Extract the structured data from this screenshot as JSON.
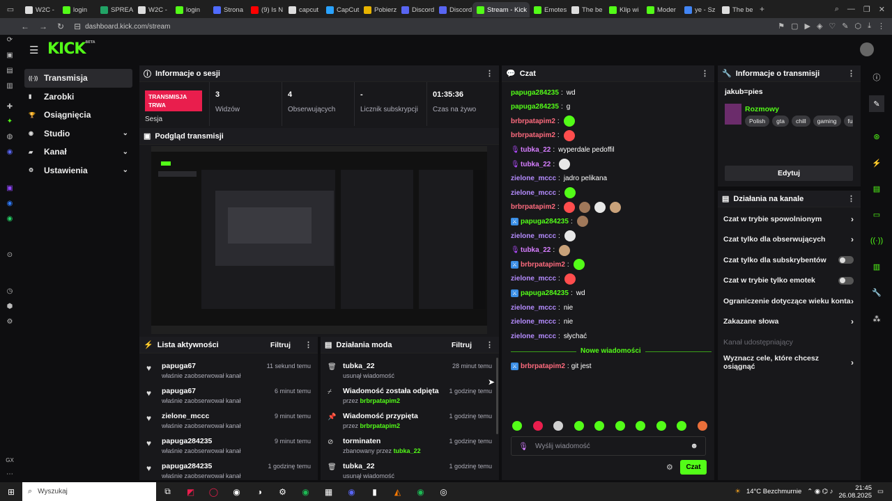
{
  "browser": {
    "tabs": [
      {
        "label": "W2C -",
        "color": "#dddddd"
      },
      {
        "label": "login",
        "color": "#53fc18"
      },
      {
        "label": "SPREAD",
        "color": "#21a366"
      },
      {
        "label": "W2C -",
        "color": "#dddddd"
      },
      {
        "label": "login",
        "color": "#53fc18"
      },
      {
        "label": "Strona",
        "color": "#4f6bff"
      },
      {
        "label": "(9) Is N",
        "color": "#ff0000"
      },
      {
        "label": "capcut",
        "color": "#dddddd"
      },
      {
        "label": "CapCut",
        "color": "#2aa3ff"
      },
      {
        "label": "Pobierz",
        "color": "#e8b400"
      },
      {
        "label": "Discord",
        "color": "#5865f2"
      },
      {
        "label": "Discord",
        "color": "#5865f2"
      },
      {
        "label": "Stream - Kick",
        "color": "#53fc18"
      },
      {
        "label": "Emotes",
        "color": "#53fc18"
      },
      {
        "label": "The be",
        "color": "#dddddd"
      },
      {
        "label": "Klip wi",
        "color": "#53fc18"
      },
      {
        "label": "Moder",
        "color": "#53fc18"
      },
      {
        "label": "ye - Sz",
        "color": "#4285f4"
      },
      {
        "label": "The be",
        "color": "#dddddd"
      }
    ],
    "url": "dashboard.kick.com/stream"
  },
  "site": {
    "logo": "KICK",
    "logo_beta": "BETA"
  },
  "sidebar": {
    "items": [
      {
        "label": "Transmisja",
        "icon": "broadcast-icon",
        "glyph": "((·))",
        "active": true,
        "chevron": false
      },
      {
        "label": "Zarobki",
        "icon": "money-icon",
        "glyph": "▮",
        "active": false,
        "chevron": false
      },
      {
        "label": "Osiągnięcia",
        "icon": "trophy-icon",
        "glyph": "🏆",
        "active": false,
        "chevron": false
      },
      {
        "label": "Studio",
        "icon": "studio-icon",
        "glyph": "◉",
        "active": false,
        "chevron": true
      },
      {
        "label": "Kanał",
        "icon": "channel-icon",
        "glyph": "▰",
        "active": false,
        "chevron": true
      },
      {
        "label": "Ustawienia",
        "icon": "gear-icon",
        "glyph": "⚙",
        "active": false,
        "chevron": true
      }
    ]
  },
  "session": {
    "title": "Informacje o sesji",
    "live_badge": "TRANSMISJA TRWA",
    "live_label": "Sesja",
    "stats": [
      {
        "value": "3",
        "label": "Widzów"
      },
      {
        "value": "4",
        "label": "Obserwujących"
      },
      {
        "value": "-",
        "label": "Licznik subskrypcji"
      },
      {
        "value": "01:35:36",
        "label": "Czas na żywo"
      }
    ]
  },
  "preview": {
    "title": "Podgląd transmisji"
  },
  "activity": {
    "title": "Lista aktywności",
    "filter": "Filtruj",
    "items": [
      {
        "name": "papuga67",
        "sub": "właśnie zaobserwował kanał",
        "time": "11 sekund temu"
      },
      {
        "name": "papuga67",
        "sub": "właśnie zaobserwował kanał",
        "time": "6 minut temu"
      },
      {
        "name": "zielone_mccc",
        "sub": "właśnie zaobserwował kanał",
        "time": "9 minut temu"
      },
      {
        "name": "papuga284235",
        "sub": "właśnie zaobserwował kanał",
        "time": "9 minut temu"
      },
      {
        "name": "papuga284235",
        "sub": "właśnie zaobserwował kanał",
        "time": "1 godzinę temu"
      }
    ]
  },
  "mod": {
    "title": "Działania moda",
    "filter": "Filtruj",
    "items": [
      {
        "name": "tubka_22",
        "sub": "usunął wiadomość",
        "who": "",
        "time": "28 minut temu",
        "icon": "trash-icon",
        "glyph": "🗑"
      },
      {
        "name": "Wiadomość została odpięta",
        "sub": "przez",
        "who": "brbrpatapim2",
        "time": "1 godzinę temu",
        "icon": "unpin-icon",
        "glyph": "⌿"
      },
      {
        "name": "Wiadomość przypięta",
        "sub": "przez",
        "who": "brbrpatapim2",
        "time": "1 godzinę temu",
        "icon": "pin-icon",
        "glyph": "📌"
      },
      {
        "name": "torminaten",
        "sub": "zbanowany przez",
        "who": "tubka_22",
        "time": "1 godzinę temu",
        "icon": "ban-icon",
        "glyph": "⊘"
      },
      {
        "name": "tubka_22",
        "sub": "usunął wiadomość",
        "who": "",
        "time": "1 godzinę temu",
        "icon": "trash-icon",
        "glyph": "🗑"
      }
    ]
  },
  "chat": {
    "title": "Czat",
    "messages": [
      {
        "user": "papuga284235",
        "text": "wd",
        "color": "#53fc18",
        "emotes": 0,
        "badge": ""
      },
      {
        "user": "papuga284235",
        "text": "g",
        "color": "#53fc18",
        "emotes": 0,
        "badge": ""
      },
      {
        "user": "brbrpatapim2",
        "text": "",
        "color": "#ff6b7e",
        "emotes": 1,
        "badge": ""
      },
      {
        "user": "brbrpatapim2",
        "text": "",
        "color": "#ff6b7e",
        "emotes": 1,
        "badge": ""
      },
      {
        "user": "tubka_22",
        "text": "wyperdale pedoffil",
        "color": "#d67eff",
        "emotes": 0,
        "badge": "mic"
      },
      {
        "user": "tubka_22",
        "text": "",
        "color": "#d67eff",
        "emotes": 1,
        "badge": "mic"
      },
      {
        "user": "zielone_mccc",
        "text": "jadro pelikana",
        "color": "#b58cff",
        "emotes": 0,
        "badge": ""
      },
      {
        "user": "zielone_mccc",
        "text": "",
        "color": "#b58cff",
        "emotes": 1,
        "badge": ""
      },
      {
        "user": "brbrpatapim2",
        "text": "",
        "color": "#ff6b7e",
        "emotes": 4,
        "badge": ""
      },
      {
        "user": "papuga284235",
        "text": "",
        "color": "#53fc18",
        "emotes": 1,
        "badge": "mod"
      },
      {
        "user": "zielone_mccc",
        "text": "",
        "color": "#b58cff",
        "emotes": 1,
        "badge": ""
      },
      {
        "user": "tubka_22",
        "text": "",
        "color": "#d67eff",
        "emotes": 1,
        "badge": "mic"
      },
      {
        "user": "brbrpatapim2",
        "text": "",
        "color": "#ff6b7e",
        "emotes": 1,
        "badge": "mod"
      },
      {
        "user": "zielone_mccc",
        "text": "",
        "color": "#b58cff",
        "emotes": 1,
        "badge": ""
      },
      {
        "user": "papuga284235",
        "text": "wd",
        "color": "#53fc18",
        "emotes": 0,
        "badge": "mod"
      },
      {
        "user": "zielone_mccc",
        "text": "nie",
        "color": "#b58cff",
        "emotes": 0,
        "badge": ""
      },
      {
        "user": "zielone_mccc",
        "text": "nie",
        "color": "#b58cff",
        "emotes": 0,
        "badge": ""
      },
      {
        "user": "zielone_mccc",
        "text": "słychać",
        "color": "#b58cff",
        "emotes": 0,
        "badge": ""
      }
    ],
    "divider": "Nowe wiadomości",
    "new_message": {
      "user": "brbrpatapim2",
      "text": "git jest",
      "color": "#ff6b7e",
      "badge": "mod"
    },
    "input_placeholder": "Wyślij wiadomość",
    "send_label": "Czat"
  },
  "stream_info": {
    "title": "Informacje o transmisji",
    "stream_title": "jakub=pies",
    "category": "Rozmowy",
    "tags": [
      "Polish",
      "gta",
      "chill",
      "gaming",
      "fu"
    ],
    "edit_label": "Edytuj"
  },
  "channel_actions": {
    "title": "Działania na kanale",
    "items": [
      {
        "label": "Czat w trybie spowolnionym",
        "type": "arrow",
        "disabled": false
      },
      {
        "label": "Czat tylko dla obserwujących",
        "type": "arrow",
        "disabled": false
      },
      {
        "label": "Czat tylko dla subskrybentów",
        "type": "toggle",
        "disabled": false
      },
      {
        "label": "Czat w trybie tylko emotek",
        "type": "toggle",
        "disabled": false
      },
      {
        "label": "Ograniczenie dotyczące wieku konta",
        "type": "arrow",
        "disabled": false
      },
      {
        "label": "Zakazane słowa",
        "type": "arrow",
        "disabled": false
      },
      {
        "label": "Kanał udostępniający",
        "type": "none",
        "disabled": true
      },
      {
        "label": "Wyznacz cele, które chcesz osiągnąć",
        "type": "arrow",
        "disabled": false
      }
    ]
  },
  "taskbar": {
    "search_placeholder": "Wyszukaj",
    "weather": "14°C  Bezchmurnie",
    "time": "21:45",
    "date": "26.08.2025"
  },
  "colors": {
    "accent": "#53fc18",
    "live_red": "#e91e4d",
    "panel": "#18181b",
    "bg": "#0e0e10"
  }
}
